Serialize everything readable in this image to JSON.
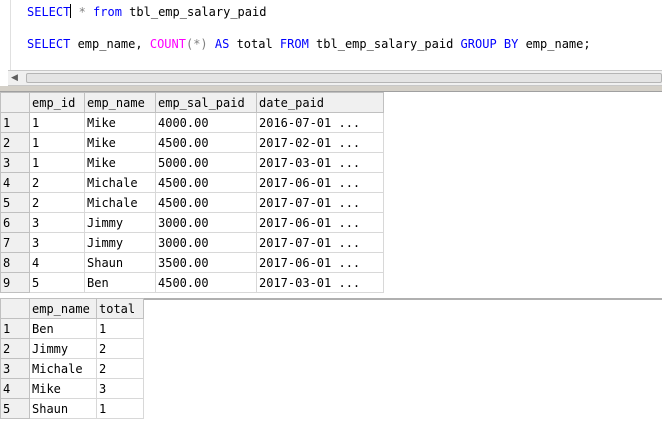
{
  "editor": {
    "lines": [
      {
        "segments": [
          {
            "text": "SELECT",
            "role": "keyword"
          },
          {
            "text": " * ",
            "role": "operator"
          },
          {
            "text": "from",
            "role": "keyword"
          },
          {
            "text": " tbl_emp_salary_paid",
            "role": "plain"
          }
        ]
      },
      {
        "segments": [
          {
            "text": "SELECT",
            "role": "keyword"
          },
          {
            "text": " emp_name, ",
            "role": "plain"
          },
          {
            "text": "COUNT",
            "role": "function"
          },
          {
            "text": "(*)",
            "role": "operator"
          },
          {
            "text": " ",
            "role": "plain"
          },
          {
            "text": "AS",
            "role": "keyword"
          },
          {
            "text": " total ",
            "role": "plain"
          },
          {
            "text": "FROM",
            "role": "keyword"
          },
          {
            "text": " tbl_emp_salary_paid ",
            "role": "plain"
          },
          {
            "text": "GROUP BY",
            "role": "keyword"
          },
          {
            "text": " emp_name;",
            "role": "plain"
          }
        ]
      }
    ]
  },
  "scrollbar": {
    "left_arrow_icon": "arrow-left-icon",
    "arrow_glyph": "◀"
  },
  "results1": {
    "columns": [
      "emp_id",
      "emp_name",
      "emp_sal_paid",
      "date_paid"
    ],
    "rows": [
      {
        "n": "1",
        "cells": [
          "1",
          "Mike",
          "4000.00",
          "2016-07-01 ..."
        ]
      },
      {
        "n": "2",
        "cells": [
          "1",
          "Mike",
          "4500.00",
          "2017-02-01 ..."
        ]
      },
      {
        "n": "3",
        "cells": [
          "1",
          "Mike",
          "5000.00",
          "2017-03-01 ..."
        ]
      },
      {
        "n": "4",
        "cells": [
          "2",
          "Michale",
          "4500.00",
          "2017-06-01 ..."
        ]
      },
      {
        "n": "5",
        "cells": [
          "2",
          "Michale",
          "4500.00",
          "2017-07-01 ..."
        ]
      },
      {
        "n": "6",
        "cells": [
          "3",
          "Jimmy",
          "3000.00",
          "2017-06-01 ..."
        ]
      },
      {
        "n": "7",
        "cells": [
          "3",
          "Jimmy",
          "3000.00",
          "2017-07-01 ..."
        ]
      },
      {
        "n": "8",
        "cells": [
          "4",
          "Shaun",
          "3500.00",
          "2017-06-01 ..."
        ]
      },
      {
        "n": "9",
        "cells": [
          "5",
          "Ben",
          "4500.00",
          "2017-03-01 ..."
        ]
      }
    ]
  },
  "results2": {
    "columns": [
      "emp_name",
      "total"
    ],
    "rows": [
      {
        "n": "1",
        "cells": [
          "Ben",
          "1"
        ]
      },
      {
        "n": "2",
        "cells": [
          "Jimmy",
          "2"
        ]
      },
      {
        "n": "3",
        "cells": [
          "Michale",
          "2"
        ]
      },
      {
        "n": "4",
        "cells": [
          "Mike",
          "3"
        ]
      },
      {
        "n": "5",
        "cells": [
          "Shaun",
          "1"
        ]
      }
    ]
  },
  "colors": {
    "keyword": "#0000ff",
    "function": "#ff00ff",
    "operator": "#808080",
    "plain": "#000000"
  }
}
